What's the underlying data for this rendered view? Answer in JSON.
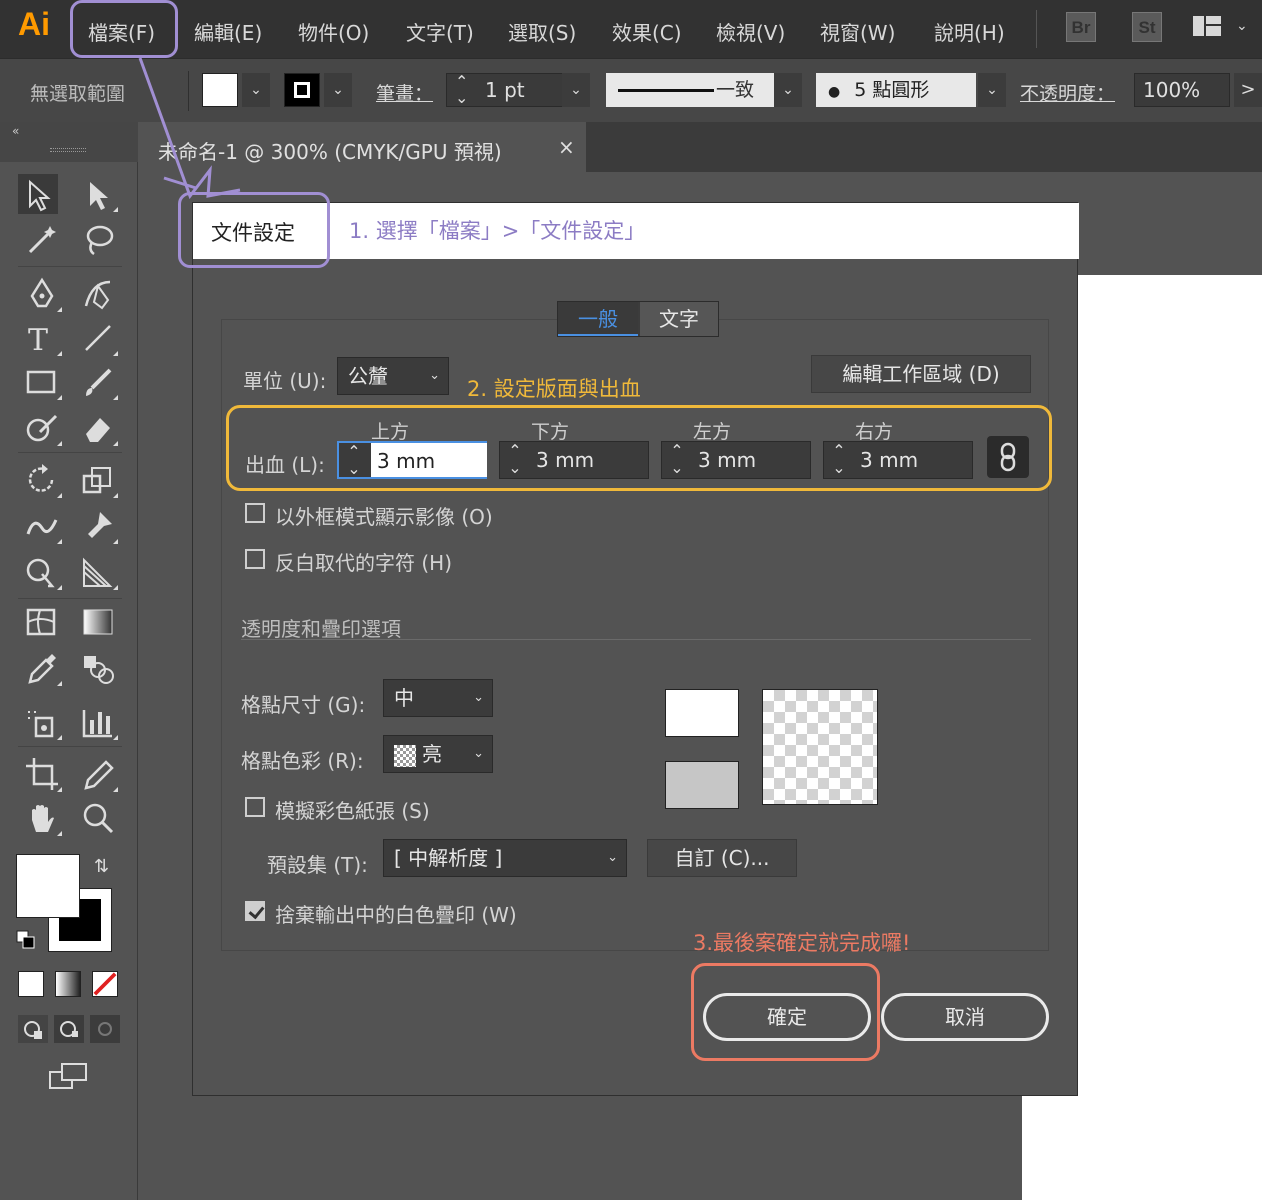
{
  "app": {
    "logo": "Ai",
    "menu": [
      "檔案(F)",
      "編輯(E)",
      "物件(O)",
      "文字(T)",
      "選取(S)",
      "效果(C)",
      "檢視(V)",
      "視窗(W)",
      "說明(H)"
    ],
    "badges": [
      "Br",
      "St"
    ]
  },
  "control_bar": {
    "selection_label": "無選取範圍",
    "stroke_label": "筆畫：",
    "stroke_weight": "1 pt",
    "stroke_profile": "一致",
    "brush": "5 點圓形",
    "opacity_label": "不透明度：",
    "opacity_value": "100%",
    "more_arrow": ">"
  },
  "document_tab": {
    "title": "未命名-1 @ 300% (CMYK/GPU 預視)",
    "close": "×"
  },
  "dialog": {
    "title": "文件設定",
    "tabs": [
      "一般",
      "文字"
    ],
    "units_label": "單位 (U):",
    "units_value": "公釐",
    "edit_artboards_button": "編輯工作區域 (D)",
    "bleed_label": "出血 (L):",
    "bleed_headers": [
      "上方",
      "下方",
      "左方",
      "右方"
    ],
    "bleed_values": [
      "3 mm",
      "3 mm",
      "3 mm",
      "3 mm"
    ],
    "show_images_outline": "以外框模式顯示影像 (O)",
    "highlight_substituted": "反白取代的字符 (H)",
    "transparency_section": "透明度和疊印選項",
    "grid_size_label": "格點尺寸 (G):",
    "grid_size_value": "中",
    "grid_colors_label": "格點色彩 (R):",
    "grid_colors_value": "亮",
    "simulate_paper": "模擬彩色紙張 (S)",
    "preset_label": "預設集 (T):",
    "preset_value": "[ 中解析度 ]",
    "custom_button": "自訂 (C)...",
    "discard_white": "捨棄輸出中的白色疊印 (W)",
    "discard_white_checked": true,
    "ok_button": "確定",
    "cancel_button": "取消"
  },
  "annotations": {
    "step1": "1. 選擇「檔案」>「文件設定」",
    "step2": "2. 設定版面與出血",
    "step3": "3.最後案確定就完成囉!"
  },
  "colors": {
    "accent_purple": "#a18fd3",
    "accent_orange": "#f0b93a",
    "accent_salmon": "#ec7a63",
    "logo_orange": "#ff9a00",
    "tab_blue": "#4a90e2"
  }
}
